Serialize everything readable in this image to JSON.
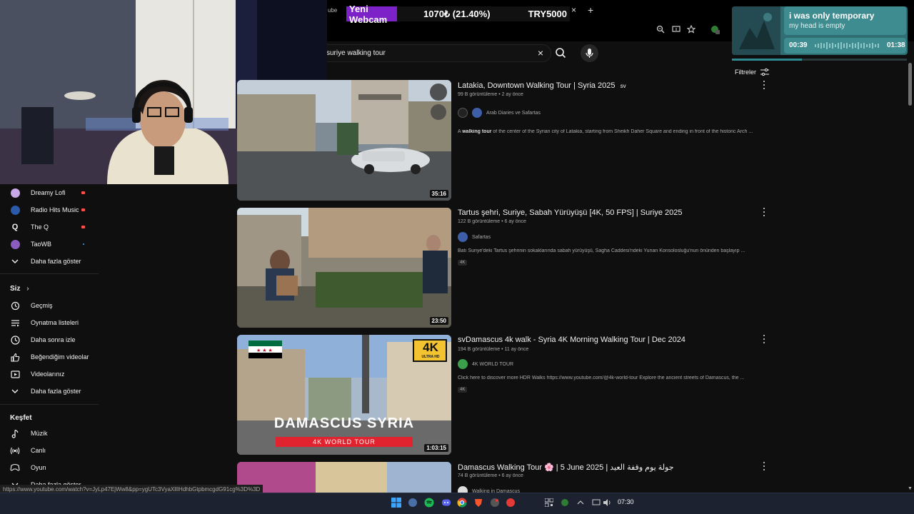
{
  "browser": {
    "tab_fragment": "ube",
    "tab_close": "×",
    "tab_new": "+",
    "status_url": "https://www.youtube.com/watch?v=JyLp47EjWw8&pp=ygUTc3VyaXllIHdhbGtpbmcgdG91cg%3D%3D"
  },
  "donation": {
    "name": "Yeni Webcam",
    "amount": "1070₺ (21.40%)",
    "currency_goal": "TRY5000"
  },
  "music": {
    "title": "i was only temporary",
    "subtitle": "my head is empty",
    "elapsed": "00:39",
    "total": "01:38",
    "progress": 0.4
  },
  "search": {
    "query": "suriye walking tour",
    "clear_icon": "×"
  },
  "filters_label": "Filtreler",
  "sidebar": {
    "subscriptions": [
      {
        "label": "Dreamy Lofi",
        "color": "#c8a8e8",
        "live": true
      },
      {
        "label": "Radio Hits Music",
        "color": "#2a5aa8",
        "live": true
      },
      {
        "label": "The Q",
        "color": "#ffffff",
        "live": true
      },
      {
        "label": "TaoWB",
        "color": "#8a5cc0",
        "live": false,
        "dot": true
      }
    ],
    "show_more": "Daha fazla göster",
    "you_header": "Siz",
    "you_items": [
      {
        "label": "Geçmiş",
        "icon": "history-icon"
      },
      {
        "label": "Oynatma listeleri",
        "icon": "playlist-icon"
      },
      {
        "label": "Daha sonra izle",
        "icon": "clock-icon"
      },
      {
        "label": "Beğendiğim videolar",
        "icon": "thumbs-up-icon"
      },
      {
        "label": "Videolarınız",
        "icon": "video-icon"
      }
    ],
    "you_more": "Daha fazla göster",
    "explore_header": "Keşfet",
    "explore_items": [
      {
        "label": "Müzik",
        "icon": "music-icon"
      },
      {
        "label": "Canlı",
        "icon": "live-icon"
      },
      {
        "label": "Oyun",
        "icon": "gaming-icon"
      }
    ],
    "explore_more": "Daha fazla göster"
  },
  "videos": [
    {
      "title": "Latakia, Downtown Walking Tour | Syria 2025",
      "title_suffix": "sv",
      "meta": "99 B görüntüleme • 2 ay önce",
      "channel": "Arab Diaries ve Safartas",
      "description_bold": "walking tour",
      "description_pre": "A ",
      "description_post": " of the center of the Syrian city of Latakia, starting from Sheikh Daher Square and ending in front of the historic Arch ...",
      "duration": "35:16",
      "badge": ""
    },
    {
      "title": "Tartus şehri, Suriye, Sabah Yürüyüşü [4K, 50 FPS] | Suriye 2025",
      "title_suffix": "",
      "meta": "122 B görüntüleme • 6 ay önce",
      "channel": "Safartas",
      "description_bold": "",
      "description_pre": "Batı Suriye'deki Tartus şehrinin sokaklarında sabah yürüyüşü, Sagha Caddesi'ndeki Yunan Konsolosluğu'nun önünden başlayıp ...",
      "description_post": "",
      "duration": "23:50",
      "badge": "4K"
    },
    {
      "title": "svDamascus 4k walk - Syria 4K Morning Walking Tour | Dec 2024",
      "title_suffix": "",
      "meta": "194 B görüntüleme • 11 ay önce",
      "channel": "4K WORLD TOUR",
      "description_bold": "",
      "description_pre": "Click here to discover more HDR Walks https://www.youtube.com/@4k-world-tour Explore the ancient streets of Damascus, the ...",
      "description_post": "",
      "duration": "1:03:15",
      "badge": "4K",
      "thumb_text": "DAMASCUS SYRIA",
      "thumb_sub": "4K WORLD TOUR",
      "thumb_badge": "4K",
      "thumb_badge_sub": "ULTRA HD"
    },
    {
      "title": "Damascus Walking Tour 🌸 | 5 June 2025 | جولة يوم وقفة العيد",
      "title_suffix": "",
      "meta": "74 B görüntüleme • 6 ay önce",
      "channel": "Walking in Damascus",
      "description_bold": "",
      "description_pre": "",
      "description_post": "",
      "duration": "",
      "badge": ""
    }
  ],
  "taskbar": {
    "time": "07:30"
  },
  "colors": {
    "background": "#0f0f0f",
    "donation_accent": "#7d22c8",
    "music_panel": "#3e8c8f",
    "taskbar": "#1c2230"
  }
}
